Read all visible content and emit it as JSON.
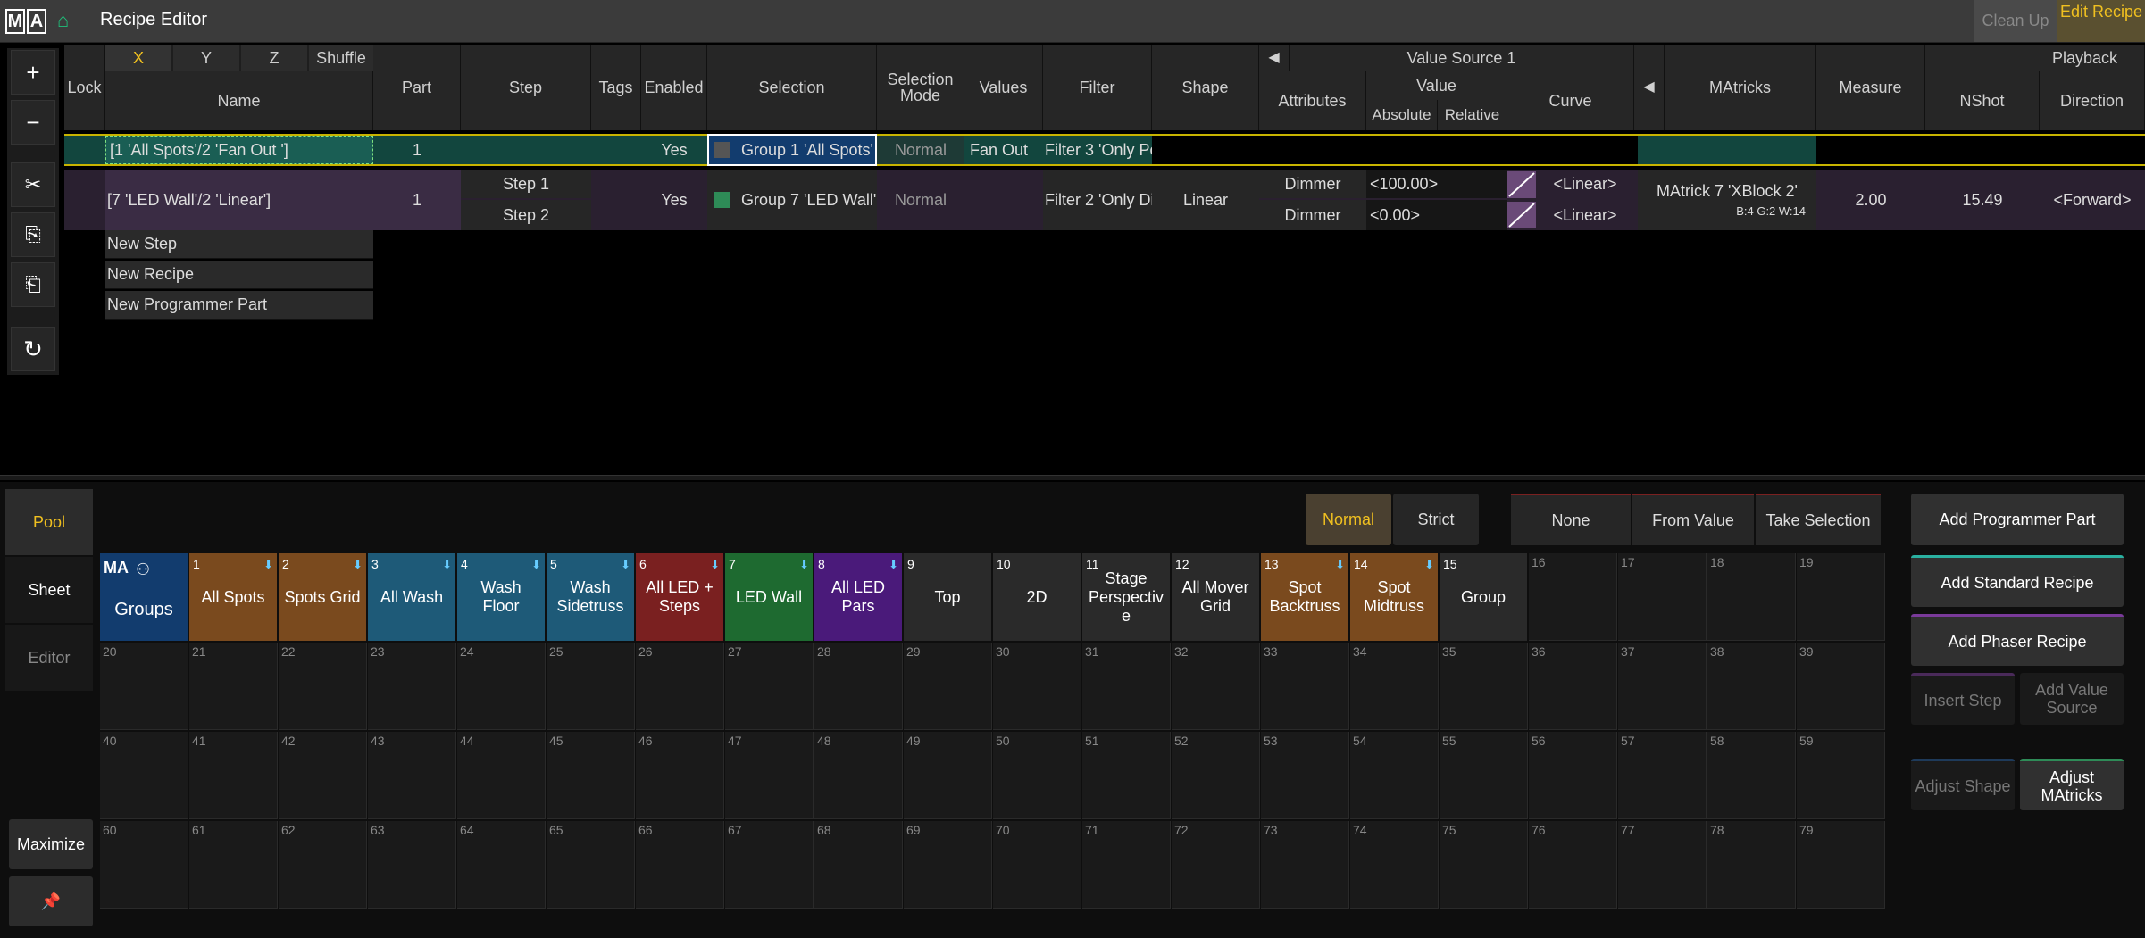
{
  "app": {
    "logo": [
      "M",
      "A"
    ],
    "title": "Recipe Editor",
    "clean_up": "Clean Up",
    "edit_recipe": "Edit Recipe"
  },
  "toolbar": {
    "add": "+",
    "remove": "−",
    "cut": "✂",
    "copy": "⎘",
    "paste": "⎗",
    "refresh": "↻"
  },
  "headers": {
    "lock": "Lock",
    "x": "X",
    "y": "Y",
    "z": "Z",
    "shuffle": "Shuffle",
    "name": "Name",
    "part": "Part",
    "step": "Step",
    "tags": "Tags",
    "enabled": "Enabled",
    "selection": "Selection",
    "selection_mode": "Selection Mode",
    "values": "Values",
    "filter": "Filter",
    "shape": "Shape",
    "value_source": "Value Source 1",
    "attributes": "Attributes",
    "value": "Value",
    "absolute": "Absolute",
    "relative": "Relative",
    "curve": "Curve",
    "matricks": "MAtricks",
    "measure": "Measure",
    "playback": "Playback",
    "nshot": "NShot",
    "direction": "Direction"
  },
  "rows": [
    {
      "name": "[1 'All Spots'/2 'Fan Out ']",
      "part": "1",
      "enabled": "Yes",
      "selection": "Group 1 'All Spots'",
      "selection_mode": "Normal",
      "values": "Fan Out",
      "filter": "Filter 3 'Only Po",
      "color": "#555555"
    },
    {
      "name": "[7 'LED Wall'/2 'Linear']",
      "part": "1",
      "steps": [
        "Step 1",
        "Step 2"
      ],
      "enabled": "Yes",
      "selection": "Group 7 'LED Wall'",
      "selection_mode": "Normal",
      "filter": "Filter 2 'Only Dir",
      "shape": "Linear",
      "attributes": [
        "Dimmer",
        "Dimmer"
      ],
      "abs_values": [
        "<100.00>",
        "<0.00>"
      ],
      "curves": [
        "<Linear>",
        "<Linear>"
      ],
      "matricks": "MAtrick 7 'XBlock 2'",
      "matricks_sub": "B:4 G:2 W:14",
      "measure": "2.00",
      "nshot": "15.49",
      "direction": "<Forward>",
      "color": "#2e8b57"
    }
  ],
  "new_items": [
    "New Step",
    "New Recipe",
    "New Programmer Part"
  ],
  "side_tabs": [
    "Pool",
    "Sheet",
    "Editor"
  ],
  "maximize": "Maximize",
  "mode": {
    "normal": "Normal",
    "strict": "Strict"
  },
  "actions": {
    "none": "None",
    "from_value": "From Value",
    "take_selection": "Take Selection"
  },
  "pool_title": "Groups",
  "pool": [
    {
      "n": "1",
      "label": "All Spots",
      "color": "#7a4a1e"
    },
    {
      "n": "2",
      "label": "Spots Grid",
      "color": "#7a4a1e"
    },
    {
      "n": "3",
      "label": "All Wash",
      "color": "#1e5a78"
    },
    {
      "n": "4",
      "label": "Wash Floor",
      "color": "#1e5a78"
    },
    {
      "n": "5",
      "label": "Wash Sidetruss",
      "color": "#1e5a78"
    },
    {
      "n": "6",
      "label": "All LED + Steps",
      "color": "#7a2020"
    },
    {
      "n": "7",
      "label": "LED Wall",
      "color": "#1e6a30"
    },
    {
      "n": "8",
      "label": "All LED Pars",
      "color": "#4a1a7a"
    },
    {
      "n": "9",
      "label": "Top",
      "color": "#2a2a2a"
    },
    {
      "n": "10",
      "label": "2D",
      "color": "#2a2a2a"
    },
    {
      "n": "11",
      "label": "Stage Perspectiv e",
      "color": "#2a2a2a"
    },
    {
      "n": "12",
      "label": "All Mover Grid",
      "color": "#2a2a2a"
    },
    {
      "n": "13",
      "label": "Spot Backtruss",
      "color": "#7a4a1e"
    },
    {
      "n": "14",
      "label": "Spot Midtruss",
      "color": "#7a4a1e"
    },
    {
      "n": "15",
      "label": "Group",
      "color": "#2a2a2a"
    }
  ],
  "empty_pool": [
    "16",
    "17",
    "18",
    "19",
    "20",
    "21",
    "22",
    "23",
    "24",
    "25",
    "26",
    "27",
    "28",
    "29",
    "30",
    "31",
    "32",
    "33",
    "34",
    "35",
    "36",
    "37",
    "38",
    "39",
    "40",
    "41",
    "42",
    "43",
    "44",
    "45",
    "46",
    "47",
    "48",
    "49",
    "50",
    "51",
    "52",
    "53",
    "54",
    "55",
    "56",
    "57",
    "58",
    "59",
    "60",
    "61",
    "62",
    "63",
    "64",
    "65",
    "66",
    "67",
    "68",
    "69",
    "70",
    "71",
    "72",
    "73",
    "74",
    "75",
    "76",
    "77",
    "78",
    "79"
  ],
  "right_buttons": {
    "add_programmer_part": "Add Programmer Part",
    "add_standard_recipe": "Add Standard Recipe",
    "add_phaser_recipe": "Add Phaser Recipe",
    "insert_step": "Insert Step",
    "add_value_source": "Add Value Source",
    "adjust_shape": "Adjust Shape",
    "adjust_matricks": "Adjust MAtricks"
  }
}
